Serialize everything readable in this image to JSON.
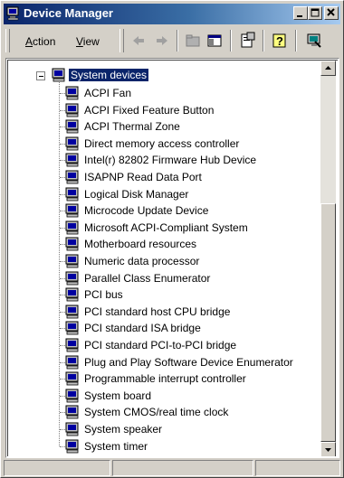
{
  "window": {
    "title": "Device Manager",
    "icon": "computer-icon",
    "controls": [
      "minimize-icon",
      "maximize-icon",
      "close-icon"
    ],
    "title_gradient": [
      "#0a246a",
      "#a6caf0"
    ]
  },
  "menu": {
    "items": [
      {
        "label": "Action",
        "accesskey": "A"
      },
      {
        "label": "View",
        "accesskey": "V"
      }
    ]
  },
  "toolbar": {
    "tools": [
      "back-arrow-icon",
      "forward-arrow-icon",
      "up-folder-icon",
      "show-hide-tree-icon",
      "properties-icon",
      "help-icon",
      "computer-properties-icon"
    ]
  },
  "tree": {
    "root": {
      "label": "System devices",
      "icon": "system-devices-icon",
      "expanded": true,
      "selected": true
    },
    "children": [
      "ACPI Fan",
      "ACPI Fixed Feature Button",
      "ACPI Thermal Zone",
      "Direct memory access controller",
      "Intel(r) 82802 Firmware Hub Device",
      "ISAPNP Read Data Port",
      "Logical Disk Manager",
      "Microcode Update Device",
      "Microsoft ACPI-Compliant System",
      "Motherboard resources",
      "Numeric data processor",
      "Parallel Class Enumerator",
      "PCI bus",
      "PCI standard host CPU bridge",
      "PCI standard ISA bridge",
      "PCI standard PCI-to-PCI bridge",
      "Plug and Play Software Device Enumerator",
      "Programmable interrupt controller",
      "System board",
      "System CMOS/real time clock",
      "System speaker",
      "System timer"
    ]
  },
  "scrollbar": {
    "up": "scroll-up-arrow-icon",
    "down": "scroll-down-arrow-icon"
  },
  "colors": {
    "selection": "#0a246a",
    "face": "#d4d0c8"
  }
}
